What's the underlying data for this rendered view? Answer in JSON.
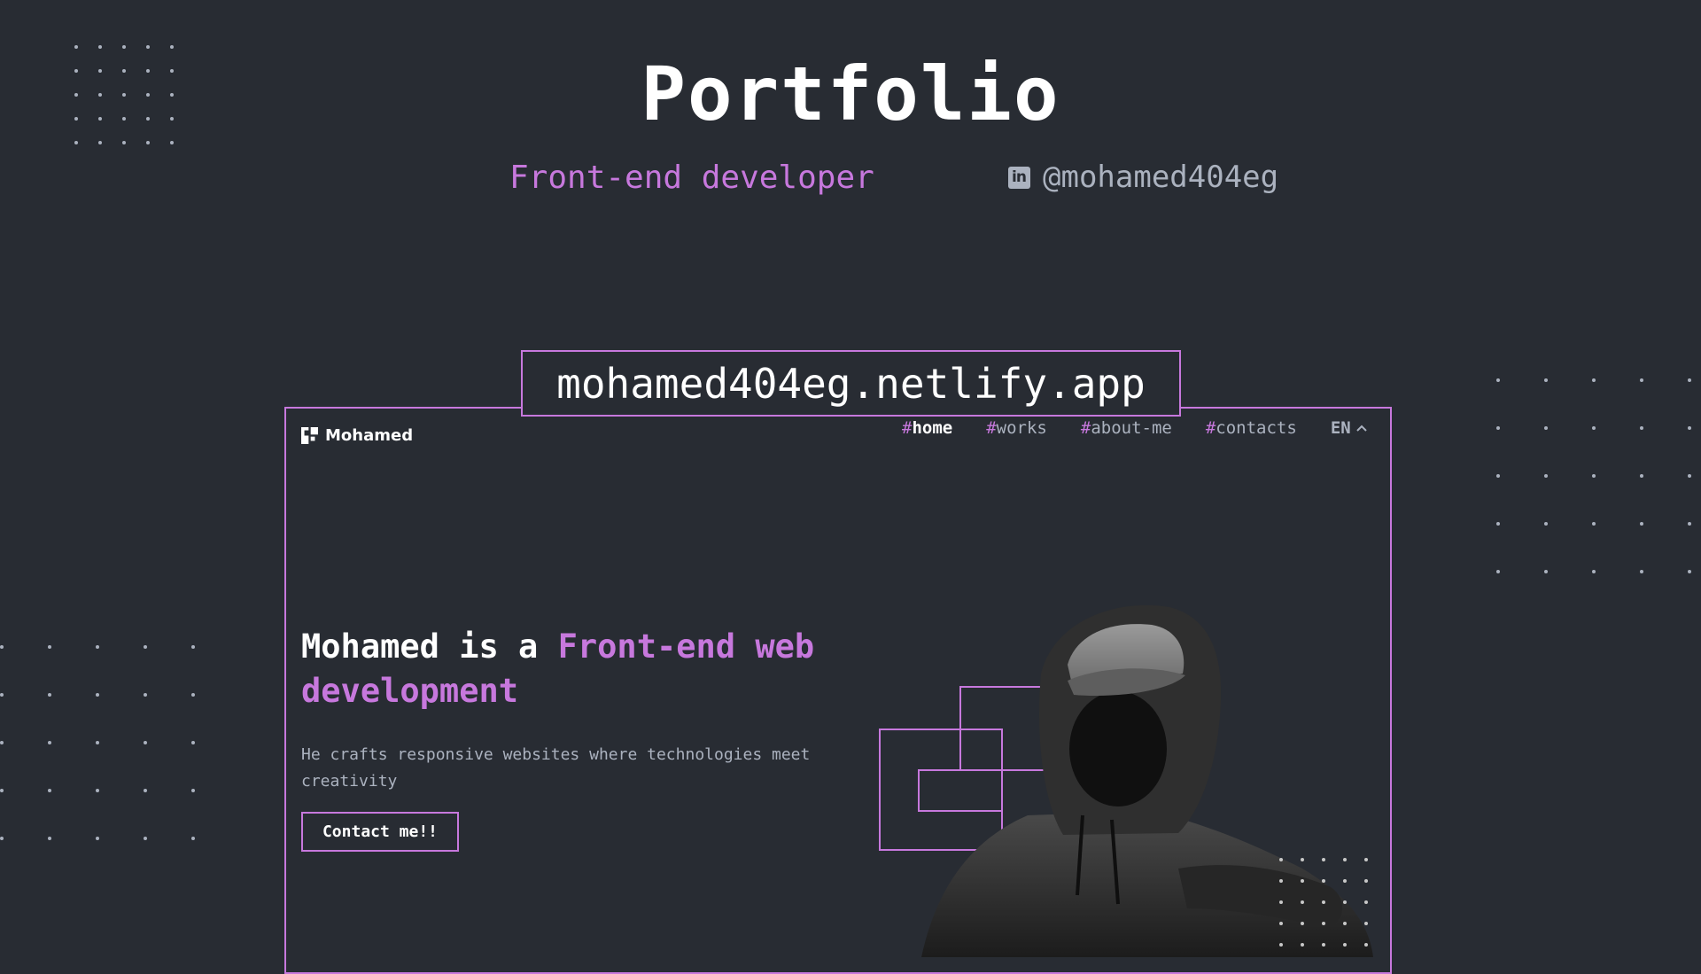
{
  "header": {
    "title": "Portfolio",
    "subtitle": "Front-end developer",
    "linkedin_icon": "linkedin-icon",
    "handle": "@mohamed404eg"
  },
  "preview": {
    "url": "mohamed404eg.netlify.app",
    "logo_icon": "logo-icon",
    "logo_text": "Mohamed",
    "nav": [
      {
        "hash": "#",
        "label": "home",
        "active": true
      },
      {
        "hash": "#",
        "label": "works",
        "active": false
      },
      {
        "hash": "#",
        "label": "about-me",
        "active": false
      },
      {
        "hash": "#",
        "label": "contacts",
        "active": false
      }
    ],
    "lang": "EN",
    "lang_icon": "chevron-up-icon",
    "hero": {
      "headline_part1": "Mohamed is a ",
      "headline_accent": "Front-end web development",
      "description": "He crafts responsive websites where technologies meet creativity",
      "cta": "Contact me!!"
    }
  },
  "colors": {
    "background": "#282c33",
    "accent": "#c778dd",
    "text": "#ffffff",
    "muted": "#abb2bf"
  }
}
